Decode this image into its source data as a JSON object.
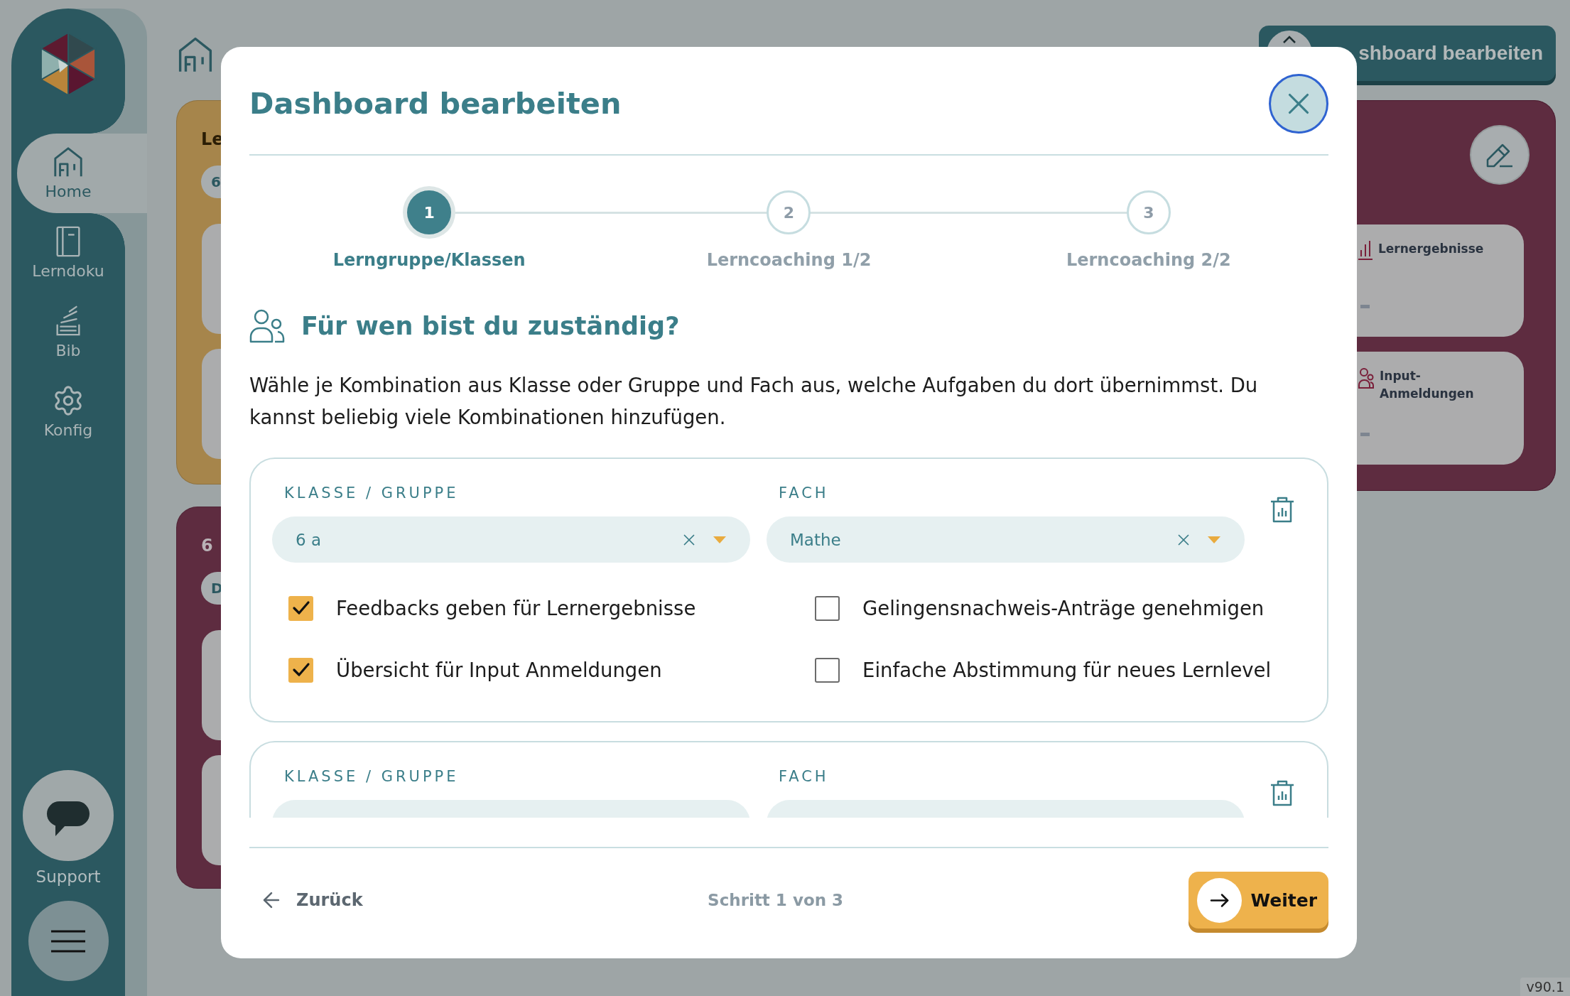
{
  "sidebar": {
    "items": [
      {
        "label": "Home",
        "selected": true
      },
      {
        "label": "Lerndoku",
        "selected": false
      },
      {
        "label": "Bib",
        "selected": false
      },
      {
        "label": "Konfig",
        "selected": false
      }
    ],
    "support": "Support"
  },
  "dashboard": {
    "edit_button": "shboard bearbeiten",
    "cards": [
      {
        "title": "Le",
        "chip": "6",
        "color": "#a6854b"
      },
      {
        "title": "6",
        "chip": "D",
        "color": "#5e2c40"
      }
    ],
    "panel_items": [
      {
        "label": "Lernergebnisse"
      },
      {
        "label": "Input-Anmeldungen"
      }
    ]
  },
  "dialog": {
    "title": "Dashboard bearbeiten",
    "steps": [
      {
        "number": "1",
        "label": "Lerngruppe/Klassen",
        "selected": true
      },
      {
        "number": "2",
        "label": "Lerncoaching 1/2",
        "selected": false
      },
      {
        "number": "3",
        "label": "Lerncoaching 2/2",
        "selected": false
      }
    ],
    "heading": "Für wen bist du zuständig?",
    "description": "Wähle je Kombination aus Klasse oder Gruppe und Fach aus, welche Aufgaben du dort übernimmst. Du kannst beliebig viele Kombinationen hinzufügen.",
    "combinations": [
      {
        "class_label": "KLASSE / GRUPPE",
        "class_value": "6 a",
        "subject_label": "FACH",
        "subject_value": "Mathe",
        "tasks": [
          {
            "label": "Feedbacks geben für Lernergebnisse",
            "checked": true
          },
          {
            "label": "Gelingensnachweis-Anträge genehmigen",
            "checked": false
          },
          {
            "label": "Übersicht für Input Anmeldungen",
            "checked": true
          },
          {
            "label": "Einfache Abstimmung für neues Lernlevel",
            "checked": false
          }
        ]
      },
      {
        "class_label": "KLASSE / GRUPPE",
        "subject_label": "FACH"
      }
    ],
    "footer": {
      "back": "Zurück",
      "progress": "Schritt 1 von 3",
      "next": "Weiter"
    }
  },
  "version": "v90.1"
}
